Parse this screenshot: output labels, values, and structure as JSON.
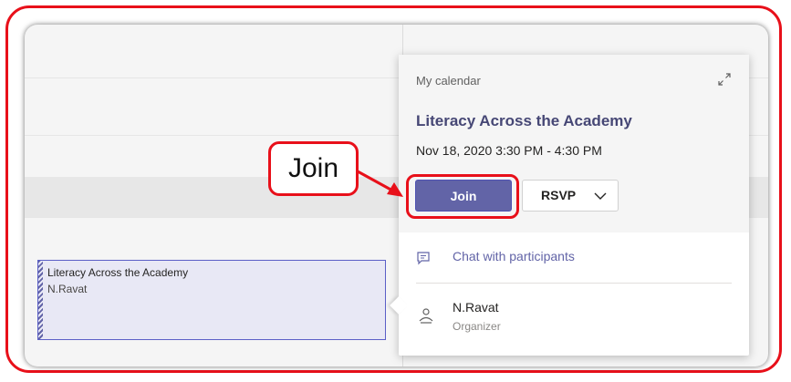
{
  "colors": {
    "annotation_red": "#e8101a",
    "teams_purple": "#6264a7",
    "title_purple": "#464775"
  },
  "annotation": {
    "callout_text": "Join"
  },
  "calendar_event": {
    "title": "Literacy Across the Academy",
    "organizer": "N.Ravat"
  },
  "popup": {
    "calendar_label": "My calendar",
    "expand_icon": "expand-icon",
    "title": "Literacy Across the Academy",
    "datetime": "Nov 18, 2020 3:30 PM - 4:30 PM",
    "join_label": "Join",
    "rsvp_label": "RSVP",
    "rsvp_icon": "chevron-down-icon",
    "chat_icon": "chat-icon",
    "chat_label": "Chat with participants",
    "organizer_icon": "person-icon",
    "organizer_name": "N.Ravat",
    "organizer_role": "Organizer"
  }
}
